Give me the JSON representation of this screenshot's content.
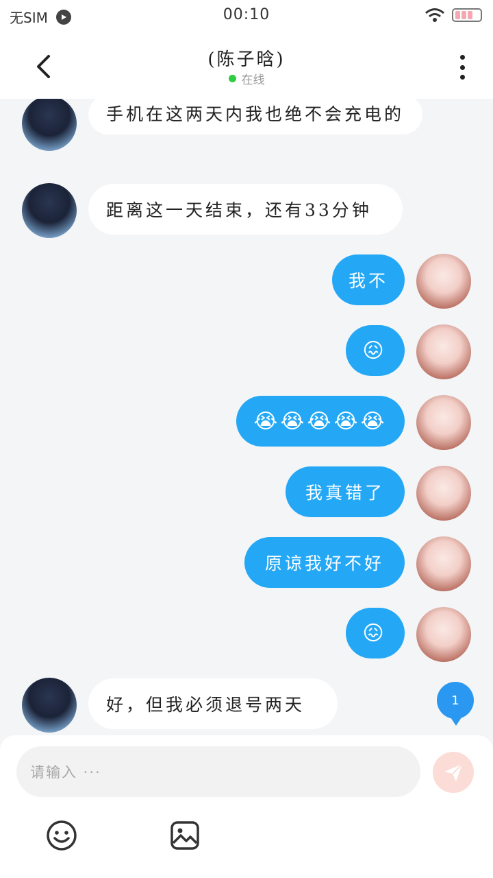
{
  "status_bar": {
    "carrier": "无SIM",
    "time": "00:10"
  },
  "header": {
    "title": "(陈子晗)",
    "status": "在线"
  },
  "messages": [
    {
      "side": "in",
      "text": "手机在这两天内我也绝不会充电的"
    },
    {
      "side": "in",
      "text": "距离这一天结束，还有33分钟"
    },
    {
      "side": "out",
      "text": "我不"
    },
    {
      "side": "out",
      "text": "😖"
    },
    {
      "side": "out",
      "text": "😭😭😭😭😭"
    },
    {
      "side": "out",
      "text": "我真错了"
    },
    {
      "side": "out",
      "text": "原谅我好不好"
    },
    {
      "side": "out",
      "text": "😖"
    },
    {
      "side": "in",
      "text": "好，但我必须退号两天"
    }
  ],
  "unread_badge": "1",
  "input": {
    "placeholder": "请输入 ···"
  },
  "icons": {
    "back": "chevron-left-icon",
    "more": "more-vertical-icon",
    "send": "send-icon",
    "emoji": "emoji-icon",
    "image": "image-icon"
  },
  "colors": {
    "outgoing_bubble": "#24a8f6",
    "incoming_bubble": "#ffffff",
    "online": "#2ecc40",
    "send_button": "#fcdcd6"
  }
}
